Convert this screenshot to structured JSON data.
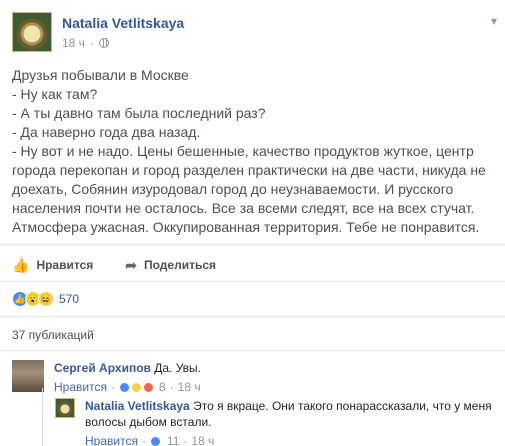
{
  "post": {
    "author": "Natalia Vetlitskaya",
    "time": "18 ч",
    "bullet": "·",
    "lines": [
      "Друзья побывали в Москве",
      "- Ну как там?",
      "- А ты давно там была последний раз?",
      "- Да наверно года два назад.",
      "- Ну вот и не надо. Цены бешенные, качество продуктов жуткое, центр города перекопан и город разделен практически на две части, никуда не доехать, Собянин изуродовал город до неузнаваемости. И русского населения почти не осталось. Все за всеми следят, все на всех стучат. Атмосфера ужасная. Оккупированная территория. Тебе не понравится."
    ]
  },
  "actions": {
    "like": "Нравится",
    "share": "Поделиться"
  },
  "reactions": {
    "count": "570"
  },
  "publications": "37 публикаций",
  "comments": [
    {
      "author": "Сергей Архипов",
      "text": "Да. Увы.",
      "like": "Нравится",
      "reaction_count": "8",
      "time": "18 ч"
    }
  ],
  "reply": {
    "author": "Natalia Vetlitskaya",
    "text": "Это я вкраце. Они такого понарассказали, что у меня волосы дыбом встали.",
    "like": "Нравится",
    "reaction_count": "11",
    "time": "18 ч"
  },
  "colors": {
    "link": "#365899",
    "muted": "#90949c",
    "text": "#4b4f56"
  }
}
